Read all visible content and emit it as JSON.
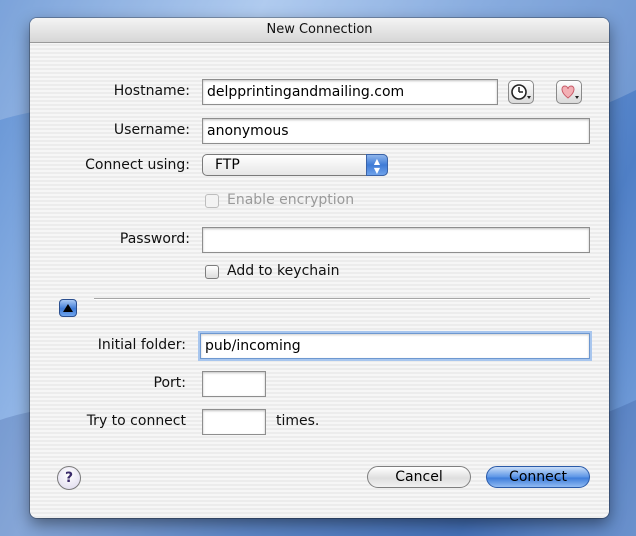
{
  "window": {
    "title": "New Connection"
  },
  "form": {
    "hostname": {
      "label": "Hostname:",
      "value": "delpprintingandmailing.com"
    },
    "username": {
      "label": "Username:",
      "value": "anonymous"
    },
    "connect_using": {
      "label": "Connect using:",
      "selected": "FTP"
    },
    "encryption": {
      "label": "Enable encryption",
      "checked": false,
      "enabled": false
    },
    "password": {
      "label": "Password:",
      "value": ""
    },
    "keychain": {
      "label": "Add to keychain",
      "checked": false
    },
    "initial_folder": {
      "label": "Initial folder:",
      "value": "pub/incoming"
    },
    "port": {
      "label": "Port:",
      "value": ""
    },
    "retries": {
      "label": "Try to connect",
      "value": "",
      "suffix": "times."
    }
  },
  "buttons": {
    "help": "?",
    "cancel": "Cancel",
    "connect": "Connect"
  },
  "icons": {
    "history": "clock-icon",
    "favorites": "heart-icon",
    "disclosure": "triangle-up-icon",
    "popup": "up-down-arrows-icon"
  }
}
